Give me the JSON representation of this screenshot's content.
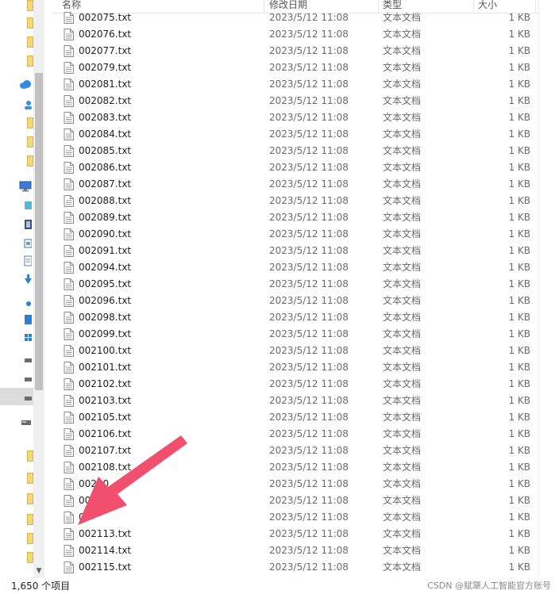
{
  "columns": {
    "name": "名称",
    "date": "修改日期",
    "type": "类型",
    "size": "大小"
  },
  "files": [
    {
      "name": "002075.txt",
      "date": "2023/5/12 11:08",
      "type": "文本文档",
      "size": "1 KB"
    },
    {
      "name": "002076.txt",
      "date": "2023/5/12 11:08",
      "type": "文本文档",
      "size": "1 KB"
    },
    {
      "name": "002077.txt",
      "date": "2023/5/12 11:08",
      "type": "文本文档",
      "size": "1 KB"
    },
    {
      "name": "002079.txt",
      "date": "2023/5/12 11:08",
      "type": "文本文档",
      "size": "1 KB"
    },
    {
      "name": "002081.txt",
      "date": "2023/5/12 11:08",
      "type": "文本文档",
      "size": "1 KB"
    },
    {
      "name": "002082.txt",
      "date": "2023/5/12 11:08",
      "type": "文本文档",
      "size": "1 KB"
    },
    {
      "name": "002083.txt",
      "date": "2023/5/12 11:08",
      "type": "文本文档",
      "size": "1 KB"
    },
    {
      "name": "002084.txt",
      "date": "2023/5/12 11:08",
      "type": "文本文档",
      "size": "1 KB"
    },
    {
      "name": "002085.txt",
      "date": "2023/5/12 11:08",
      "type": "文本文档",
      "size": "1 KB"
    },
    {
      "name": "002086.txt",
      "date": "2023/5/12 11:08",
      "type": "文本文档",
      "size": "1 KB"
    },
    {
      "name": "002087.txt",
      "date": "2023/5/12 11:08",
      "type": "文本文档",
      "size": "1 KB"
    },
    {
      "name": "002088.txt",
      "date": "2023/5/12 11:08",
      "type": "文本文档",
      "size": "1 KB"
    },
    {
      "name": "002089.txt",
      "date": "2023/5/12 11:08",
      "type": "文本文档",
      "size": "1 KB"
    },
    {
      "name": "002090.txt",
      "date": "2023/5/12 11:08",
      "type": "文本文档",
      "size": "1 KB"
    },
    {
      "name": "002091.txt",
      "date": "2023/5/12 11:08",
      "type": "文本文档",
      "size": "1 KB"
    },
    {
      "name": "002094.txt",
      "date": "2023/5/12 11:08",
      "type": "文本文档",
      "size": "1 KB"
    },
    {
      "name": "002095.txt",
      "date": "2023/5/12 11:08",
      "type": "文本文档",
      "size": "1 KB"
    },
    {
      "name": "002096.txt",
      "date": "2023/5/12 11:08",
      "type": "文本文档",
      "size": "1 KB"
    },
    {
      "name": "002098.txt",
      "date": "2023/5/12 11:08",
      "type": "文本文档",
      "size": "1 KB"
    },
    {
      "name": "002099.txt",
      "date": "2023/5/12 11:08",
      "type": "文本文档",
      "size": "1 KB"
    },
    {
      "name": "002100.txt",
      "date": "2023/5/12 11:08",
      "type": "文本文档",
      "size": "1 KB"
    },
    {
      "name": "002101.txt",
      "date": "2023/5/12 11:08",
      "type": "文本文档",
      "size": "1 KB"
    },
    {
      "name": "002102.txt",
      "date": "2023/5/12 11:08",
      "type": "文本文档",
      "size": "1 KB"
    },
    {
      "name": "002103.txt",
      "date": "2023/5/12 11:08",
      "type": "文本文档",
      "size": "1 KB"
    },
    {
      "name": "002105.txt",
      "date": "2023/5/12 11:08",
      "type": "文本文档",
      "size": "1 KB"
    },
    {
      "name": "002106.txt",
      "date": "2023/5/12 11:08",
      "type": "文本文档",
      "size": "1 KB"
    },
    {
      "name": "002107.txt",
      "date": "2023/5/12 11:08",
      "type": "文本文档",
      "size": "1 KB"
    },
    {
      "name": "002108.txt",
      "date": "2023/5/12 11:08",
      "type": "文本文档",
      "size": "1 KB"
    },
    {
      "name": "00210",
      "date": "2023/5/12 11:08",
      "type": "文本文档",
      "size": "1 KB"
    },
    {
      "name": "00",
      "date": "2023/5/12 11:08",
      "type": "文本文档",
      "size": "1 KB"
    },
    {
      "name": "00",
      "date": "2023/5/12 11:08",
      "type": "文本文档",
      "size": "1 KB"
    },
    {
      "name": "002113.txt",
      "date": "2023/5/12 11:08",
      "type": "文本文档",
      "size": "1 KB"
    },
    {
      "name": "002114.txt",
      "date": "2023/5/12 11:08",
      "type": "文本文档",
      "size": "1 KB"
    },
    {
      "name": "002115.txt",
      "date": "2023/5/12 11:08",
      "type": "文本文档",
      "size": "1 KB"
    }
  ],
  "status": {
    "item_count": "1,650 个项目"
  },
  "watermark": "CSDN @赋犟人工智能官方账号",
  "icons": {
    "file": "text-file-icon",
    "nav": [
      "cloud-icon",
      "desktop-icon",
      "folder-icon",
      "downloads-icon",
      "drive-icon",
      "network-icon"
    ]
  },
  "colors": {
    "annotation_arrow": "#f0506e",
    "folder": "#f3d87a",
    "cloud": "#2d8ce6"
  }
}
